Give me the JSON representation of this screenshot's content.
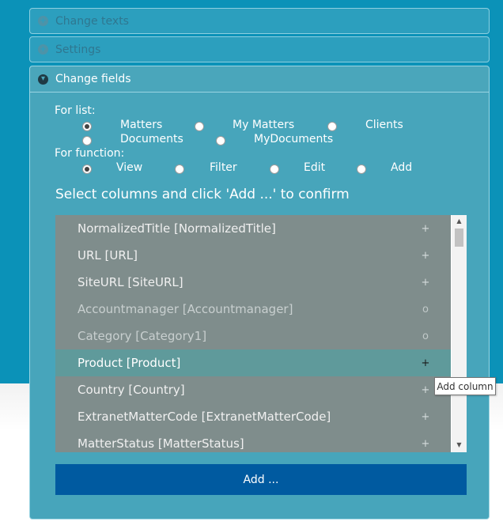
{
  "accordion": {
    "sections": [
      {
        "title": "Change texts",
        "icon": "plus-circle-icon",
        "state": "collapsed"
      },
      {
        "title": "Settings",
        "icon": "plus-circle-icon",
        "state": "collapsed"
      },
      {
        "title": "Change fields",
        "icon": "arrow-down-circle-icon",
        "state": "expanded"
      }
    ]
  },
  "form": {
    "for_list_label": "For list:",
    "list_options": [
      {
        "label": "Matters",
        "checked": true
      },
      {
        "label": "My Matters",
        "checked": false
      },
      {
        "label": "Clients",
        "checked": false
      },
      {
        "label": "Documents",
        "checked": false
      },
      {
        "label": "MyDocuments",
        "checked": false
      }
    ],
    "for_function_label": "For function:",
    "function_options": [
      {
        "label": "View",
        "checked": true
      },
      {
        "label": "Filter",
        "checked": false
      },
      {
        "label": "Edit",
        "checked": false
      },
      {
        "label": "Add",
        "checked": false
      }
    ],
    "instruction": "Select columns and click 'Add ...' to confirm"
  },
  "columns": [
    {
      "label": "NormalizedTitle [NormalizedTitle]",
      "action": "+"
    },
    {
      "label": "URL [URL]",
      "action": "+"
    },
    {
      "label": "SiteURL [SiteURL]",
      "action": "+"
    },
    {
      "label": "Accountmanager [Accountmanager]",
      "action": "o"
    },
    {
      "label": "Category [Category1]",
      "action": "o"
    },
    {
      "label": "Product [Product]",
      "action": "+"
    },
    {
      "label": "Country [Country]",
      "action": "+"
    },
    {
      "label": "ExtranetMatterCode [ExtranetMatterCode]",
      "action": "+"
    },
    {
      "label": "MatterStatus [MatterStatus]",
      "action": "+"
    }
  ],
  "add_button_label": "Add ...",
  "tooltip": "Add column",
  "colors": {
    "page_bg": "#0b92b8",
    "panel_bg": "#47a5bb",
    "row_bg": "#7f8d8c",
    "row_hover_bg": "#5f9a9b",
    "button_bg": "#005aa0"
  }
}
